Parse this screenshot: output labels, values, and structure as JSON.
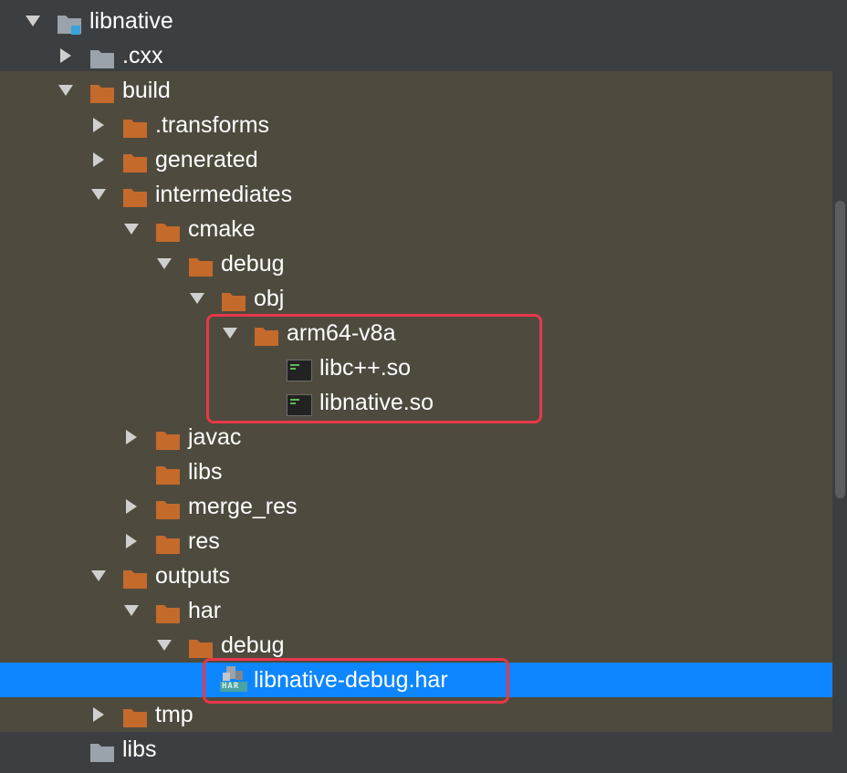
{
  "window": {
    "title": "libnative",
    "panel": "Project"
  },
  "colors": {
    "background": "#3c3f41",
    "build_band": "#4f4a3e",
    "folder_gray": "#9aa3ab",
    "folder_orange": "#c46a2b",
    "module_badge": "#3aa3d9",
    "selection": "#0d86ff",
    "highlight_border": "#e8374b",
    "arrow": "#cfcfcf",
    "so_file_bg": "#222222",
    "so_file_text": "#5fb85f",
    "har_icon_teal": "#4aa3a3"
  },
  "tree": [
    {
      "label": "libnative",
      "depth": 0,
      "arrow": "expanded",
      "icon": "module-folder-icon",
      "name": "node-libnative"
    },
    {
      "label": ".cxx",
      "depth": 1,
      "arrow": "collapsed",
      "icon": "folder-gray-icon",
      "name": "node-cxx"
    },
    {
      "label": "build",
      "depth": 1,
      "arrow": "expanded",
      "icon": "folder-orange-icon",
      "name": "node-build"
    },
    {
      "label": ".transforms",
      "depth": 2,
      "arrow": "collapsed",
      "icon": "folder-orange-icon",
      "name": "node-transforms"
    },
    {
      "label": "generated",
      "depth": 2,
      "arrow": "collapsed",
      "icon": "folder-orange-icon",
      "name": "node-generated"
    },
    {
      "label": "intermediates",
      "depth": 2,
      "arrow": "expanded",
      "icon": "folder-orange-icon",
      "name": "node-intermediates"
    },
    {
      "label": "cmake",
      "depth": 3,
      "arrow": "expanded",
      "icon": "folder-orange-icon",
      "name": "node-cmake"
    },
    {
      "label": "debug",
      "depth": 4,
      "arrow": "expanded",
      "icon": "folder-orange-icon",
      "name": "node-cmake-debug"
    },
    {
      "label": "obj",
      "depth": 5,
      "arrow": "expanded",
      "icon": "folder-orange-icon",
      "name": "node-obj"
    },
    {
      "label": "arm64-v8a",
      "depth": 6,
      "arrow": "expanded",
      "icon": "folder-orange-icon",
      "name": "node-arm64-v8a"
    },
    {
      "label": "libc++.so",
      "depth": 7,
      "arrow": "none",
      "icon": "shared-library-file-icon",
      "name": "file-libcpp-so"
    },
    {
      "label": "libnative.so",
      "depth": 7,
      "arrow": "none",
      "icon": "shared-library-file-icon",
      "name": "file-libnative-so"
    },
    {
      "label": "javac",
      "depth": 3,
      "arrow": "collapsed",
      "icon": "folder-orange-icon",
      "name": "node-javac"
    },
    {
      "label": "libs",
      "depth": 3,
      "arrow": "none",
      "icon": "folder-orange-icon",
      "name": "node-intermediates-libs"
    },
    {
      "label": "merge_res",
      "depth": 3,
      "arrow": "collapsed",
      "icon": "folder-orange-icon",
      "name": "node-merge-res"
    },
    {
      "label": "res",
      "depth": 3,
      "arrow": "collapsed",
      "icon": "folder-orange-icon",
      "name": "node-res"
    },
    {
      "label": "outputs",
      "depth": 2,
      "arrow": "expanded",
      "icon": "folder-orange-icon",
      "name": "node-outputs"
    },
    {
      "label": "har",
      "depth": 3,
      "arrow": "expanded",
      "icon": "folder-orange-icon",
      "name": "node-har"
    },
    {
      "label": "debug",
      "depth": 4,
      "arrow": "expanded",
      "icon": "folder-orange-icon",
      "name": "node-har-debug"
    },
    {
      "label": "libnative-debug.har",
      "depth": 5,
      "arrow": "none",
      "icon": "har-archive-file-icon",
      "name": "file-libnative-debug-har",
      "selected": true
    },
    {
      "label": "tmp",
      "depth": 2,
      "arrow": "collapsed",
      "icon": "folder-orange-icon",
      "name": "node-tmp"
    },
    {
      "label": "libs",
      "depth": 1,
      "arrow": "none",
      "icon": "folder-gray-icon",
      "name": "node-libs"
    }
  ],
  "icon_text": {
    "har_badge": "HAR"
  }
}
